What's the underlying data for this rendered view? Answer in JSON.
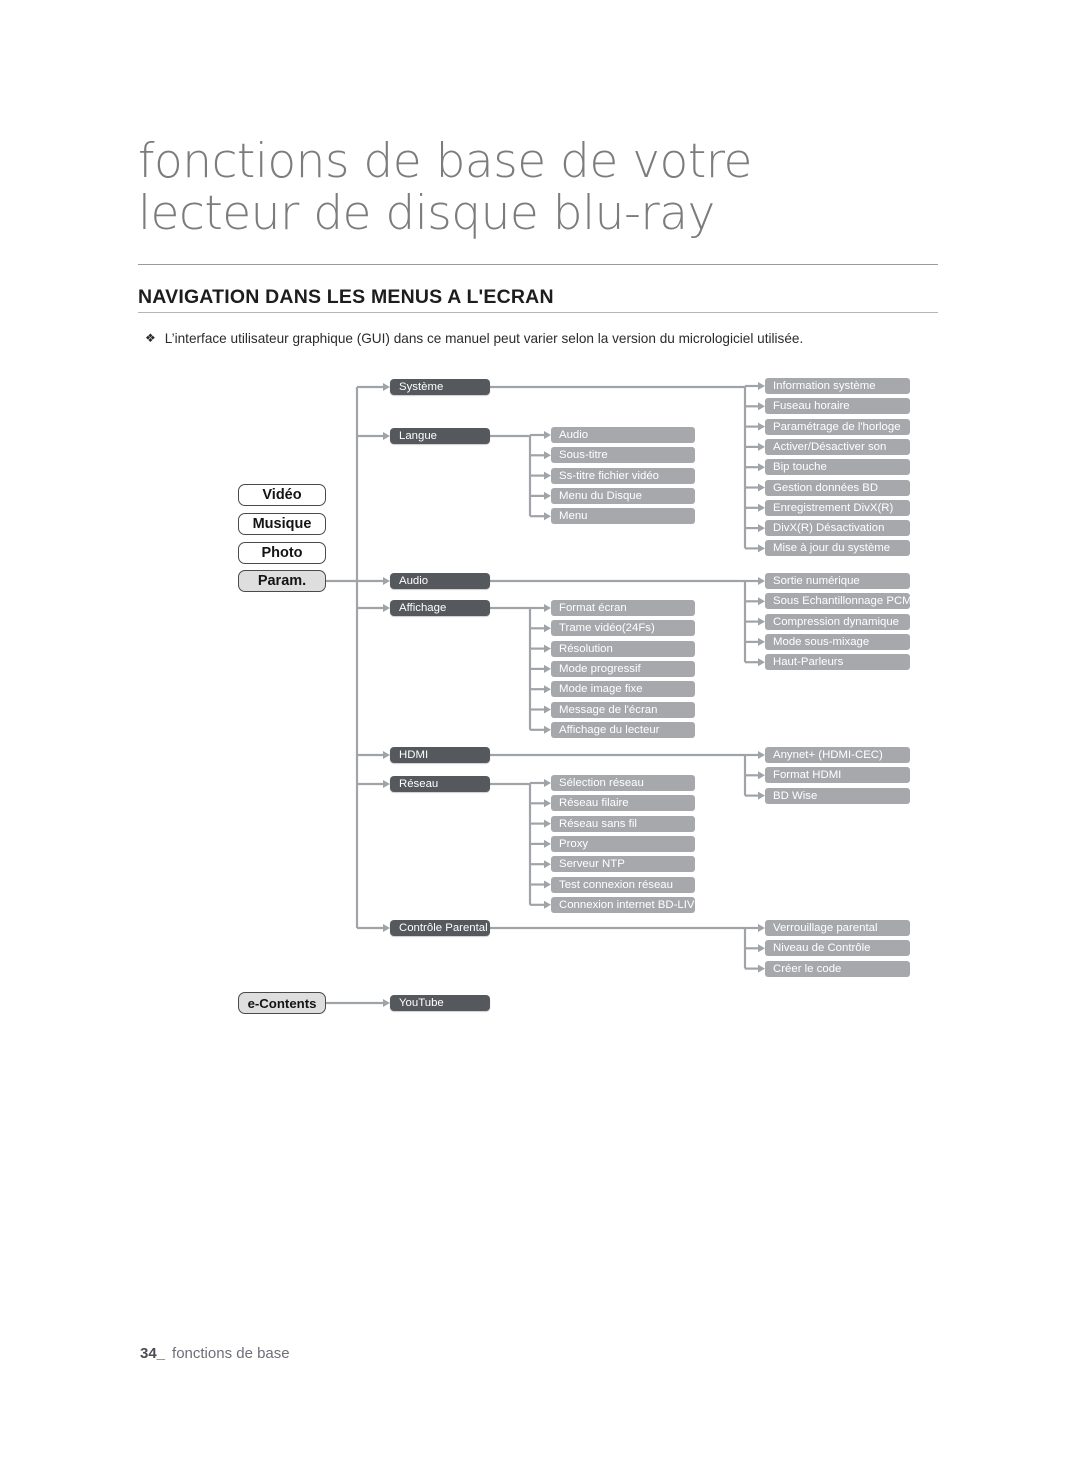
{
  "header": {
    "chapter_title": "fonctions de base de votre\nlecteur de disque blu-ray",
    "section_title": "NAVIGATION DANS LES MENUS A L'ECRAN",
    "note_bullet": "❖",
    "note_text": "L’interface utilisateur graphique (GUI) dans ce manuel peut varier selon la version du micrologiciel utilisée."
  },
  "colors": {
    "level1_box": "#55595e",
    "level2_box": "#a6a8ac",
    "root_border": "#4a4a4a",
    "root_selected_fill": "#dededf",
    "connector": "#a0a4a8",
    "text_dark": "#1d1d1d"
  },
  "diagram": {
    "roots": [
      {
        "label": "Vidéo",
        "selected": false
      },
      {
        "label": "Musique",
        "selected": false
      },
      {
        "label": "Photo",
        "selected": false
      },
      {
        "label": "Param.",
        "selected": true
      }
    ],
    "econtents": {
      "label": "e-Contents",
      "child": "YouTube"
    },
    "branches": [
      {
        "label": "Système",
        "mid": [],
        "right": [
          "Information système",
          "Fuseau horaire",
          "Paramétrage de l'horloge",
          "Activer/Désactiver son",
          "Bip touche",
          "Gestion données BD",
          "Enregistrement DivX(R)",
          "DivX(R) Désactivation",
          "Mise à jour du système"
        ]
      },
      {
        "label": "Langue",
        "mid": [
          "Audio",
          "Sous-titre",
          "Ss-titre fichier vidéo",
          "Menu du Disque",
          "Menu"
        ],
        "right": []
      },
      {
        "label": "Audio",
        "mid": [],
        "right": [
          "Sortie numérique",
          "Sous Echantillonnage PCM",
          "Compression dynamique",
          "Mode sous-mixage",
          "Haut-Parleurs"
        ]
      },
      {
        "label": "Affichage",
        "mid": [
          "Format écran",
          "Trame vidéo(24Fs)",
          "Résolution",
          "Mode progressif",
          "Mode image fixe",
          "Message de l'écran",
          "Affichage du lecteur"
        ],
        "right": []
      },
      {
        "label": "HDMI",
        "mid": [],
        "right": [
          "Anynet+ (HDMI-CEC)",
          "Format HDMI",
          "BD Wise"
        ]
      },
      {
        "label": "Réseau",
        "mid": [
          "Sélection réseau",
          "Réseau filaire",
          "Réseau sans fil",
          "Proxy",
          "Serveur NTP",
          "Test connexion réseau",
          "Connexion internet BD-LIVE"
        ],
        "right": []
      },
      {
        "label": "Contrôle Parental",
        "mid": [],
        "right": [
          "Verrouillage parental",
          "Niveau de Contrôle",
          "Créer le code"
        ]
      }
    ]
  },
  "footer": {
    "page_number": "34_",
    "label": "fonctions de base"
  }
}
